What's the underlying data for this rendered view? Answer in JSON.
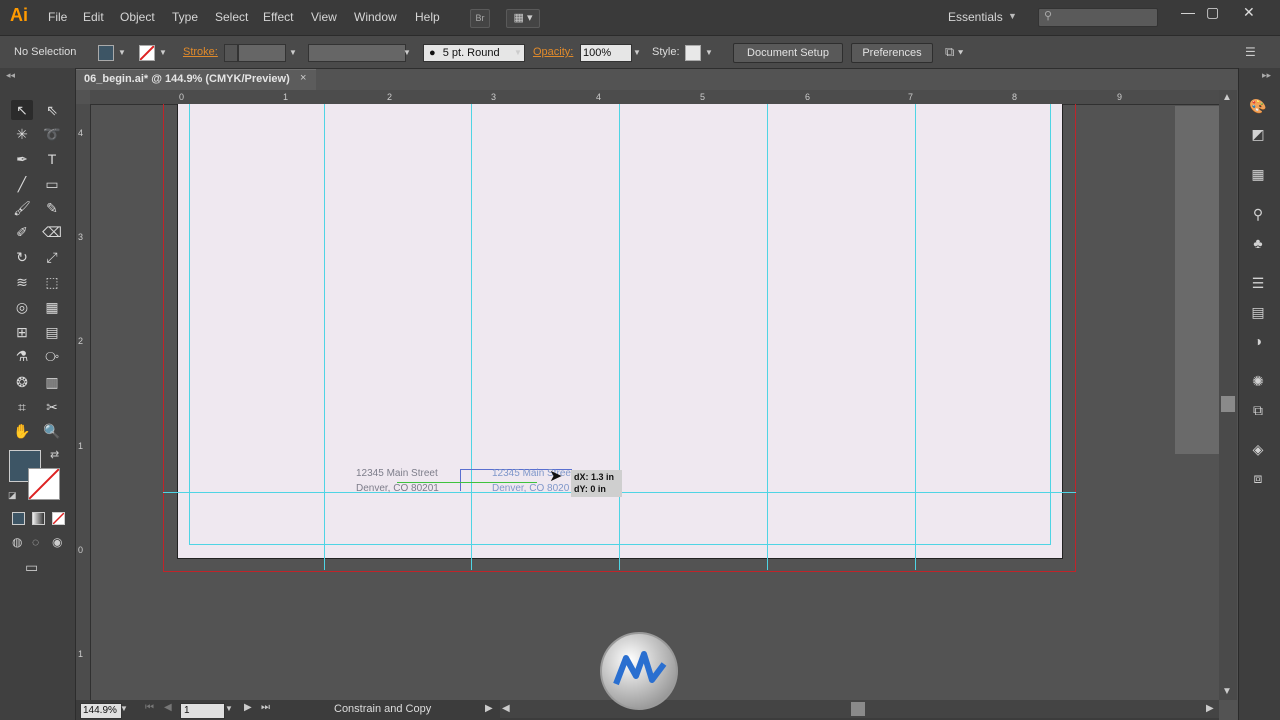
{
  "app": {
    "logo": "Ai",
    "menu": [
      "File",
      "Edit",
      "Object",
      "Type",
      "Select",
      "Effect",
      "View",
      "Window",
      "Help"
    ],
    "bridge_label": "Br",
    "workspace": "Essentials",
    "window_controls": [
      "—",
      "▢",
      "✕"
    ]
  },
  "control_bar": {
    "selection_status": "No Selection",
    "stroke_label": "Stroke:",
    "brush": "5 pt. Round",
    "opacity_label": "Opacity:",
    "opacity_value": "100%",
    "style_label": "Style:",
    "document_setup": "Document Setup",
    "preferences": "Preferences"
  },
  "document_tab": {
    "title": "06_begin.ai* @ 144.9% (CMYK/Preview)",
    "close": "×"
  },
  "rulers": {
    "horizontal": [
      "0",
      "1",
      "2",
      "3",
      "4",
      "5",
      "6",
      "7",
      "8",
      "9"
    ],
    "vertical": [
      "4",
      "3",
      "2",
      "1",
      "0",
      "1"
    ]
  },
  "canvas": {
    "address_original": [
      "12345 Main Street",
      "Denver, CO 80201"
    ],
    "address_copy": [
      "12345 Main Stree",
      "Denver, CO 8020"
    ],
    "move_tooltip": {
      "dx": "dX: 1.3 in",
      "dy": "dY: 0 in"
    }
  },
  "status_bar": {
    "zoom": "144.9%",
    "page": "1",
    "status": "Constrain and Copy"
  },
  "colors": {
    "accent": "#ff9a00",
    "guides": "#4fd4e4",
    "bleed": "#c0242a",
    "artboard": "#efe8f0"
  }
}
